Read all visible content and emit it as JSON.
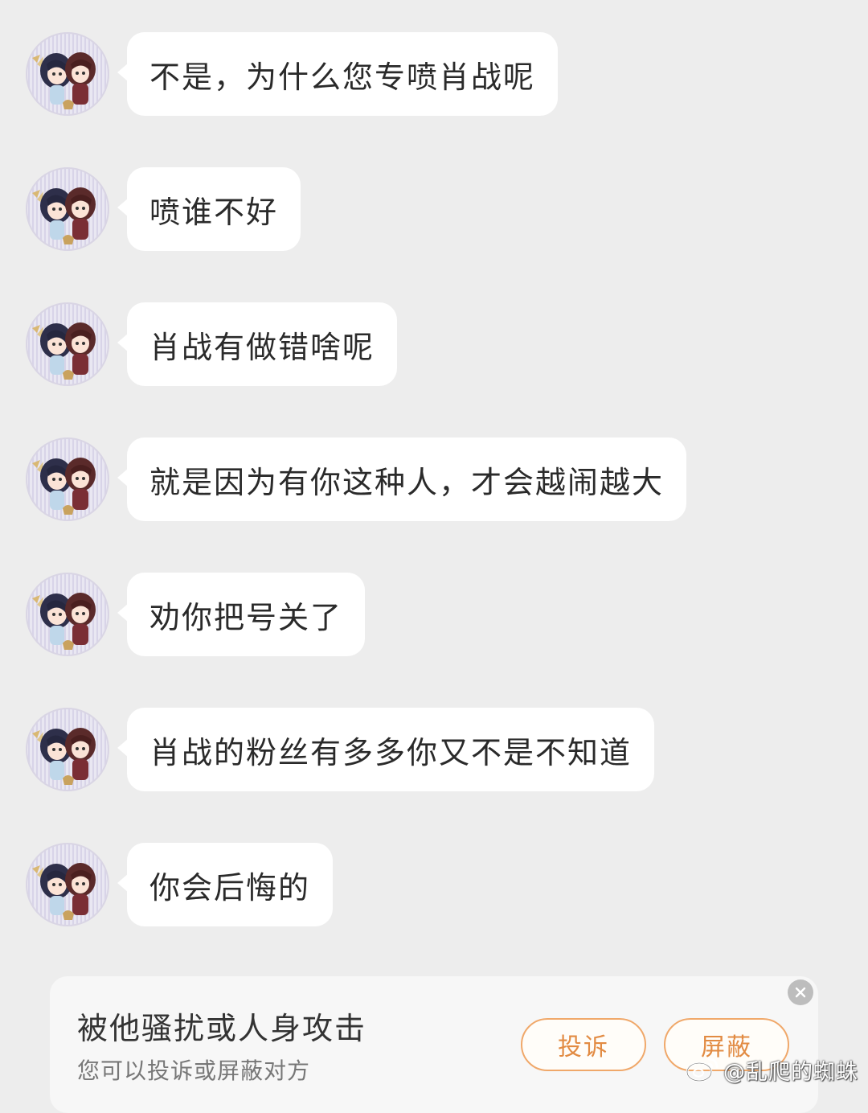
{
  "messages": [
    {
      "text": "不是，为什么您专喷肖战呢"
    },
    {
      "text": "喷谁不好"
    },
    {
      "text": "肖战有做错啥呢"
    },
    {
      "text": "就是因为有你这种人，才会越闹越大"
    },
    {
      "text": "劝你把号关了"
    },
    {
      "text": "肖战的粉丝有多多你又不是不知道"
    },
    {
      "text": "你会后悔的"
    }
  ],
  "banner": {
    "title": "被他骚扰或人身攻击",
    "subtitle": "您可以投诉或屏蔽对方",
    "complain_label": "投诉",
    "block_label": "屏蔽",
    "close_icon": "close-icon"
  },
  "watermark": {
    "icon": "weibo-logo-icon",
    "text": "@乱爬的蜘蛛"
  },
  "colors": {
    "background": "#ededed",
    "bubble": "#ffffff",
    "accent": "#e28b43"
  }
}
